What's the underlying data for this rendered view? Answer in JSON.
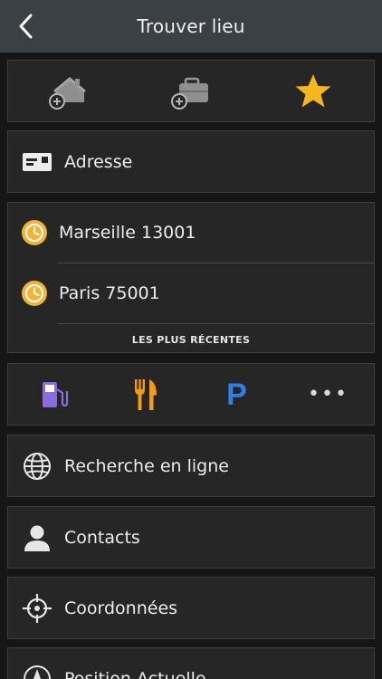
{
  "header": {
    "title": "Trouver lieu"
  },
  "top_icons": [
    {
      "name": "home-add-icon"
    },
    {
      "name": "work-add-icon"
    },
    {
      "name": "favorites-star-icon"
    }
  ],
  "address": {
    "label": "Adresse"
  },
  "recent": {
    "items": [
      {
        "label": "Marseille 13001"
      },
      {
        "label": "Paris 75001"
      }
    ],
    "caption": "LES PLUS RÉCENTES"
  },
  "poi": {
    "parking_letter": "P",
    "more_label": "•••"
  },
  "menu": {
    "online_search": "Recherche en ligne",
    "contacts": "Contacts",
    "coordinates": "Coordonnées",
    "current_position": "Position Actuelle"
  },
  "colors": {
    "header_bg": "#3b4045",
    "star": "#f5b71b",
    "history": "#f2b437",
    "fuel": "#8a6be0",
    "food": "#f39c12",
    "parking": "#2f7fe6"
  }
}
